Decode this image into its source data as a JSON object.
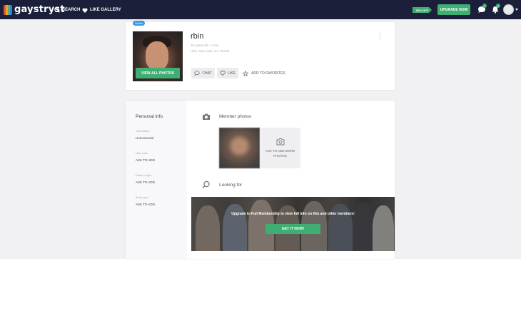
{
  "header": {
    "brand": "gaystryst",
    "nav": [
      {
        "label": "SEARCH",
        "icon": "search-icon"
      },
      {
        "label": "LIKE GALLERY",
        "icon": "heart-icon"
      }
    ],
    "discount_tag": "60% OFF",
    "upgrade_label": "UPGRADE NOW",
    "chat_count": "1",
    "notif_count": "2",
    "colors": {
      "bar": "#1b1f3a",
      "accent": "#3fae72"
    }
  },
  "profile": {
    "badge": "Online",
    "username": "rbin",
    "meta_line1": "30 years old, 1 man",
    "meta_line2": "USA, San Jose, CA, 95134",
    "view_photos_label": "VIEW ALL PHOTOS",
    "actions": {
      "chat": "CHAT",
      "like": "LIKE",
      "favorite": "ADD TO FAVORITES"
    },
    "more_symbol": "⋮"
  },
  "personal_info": {
    "title": "Personal info",
    "fields": [
      {
        "label": "Orientation",
        "value": "Homosexual"
      },
      {
        "label": "Hair color",
        "value": "ASK TO ADD"
      },
      {
        "label": "Ethnic origin",
        "value": "ASK TO ADD"
      },
      {
        "label": "Body type",
        "value": "ASK TO ADD"
      }
    ]
  },
  "member_photos": {
    "title": "Member photos",
    "add_more_label": "ASK TO ADD MORE PHOTOS"
  },
  "looking_for": {
    "title": "Looking for",
    "banner_text": "Upgrade to Full Membership to view full info on this and other members!",
    "cta_label": "GET IT NOW!"
  }
}
